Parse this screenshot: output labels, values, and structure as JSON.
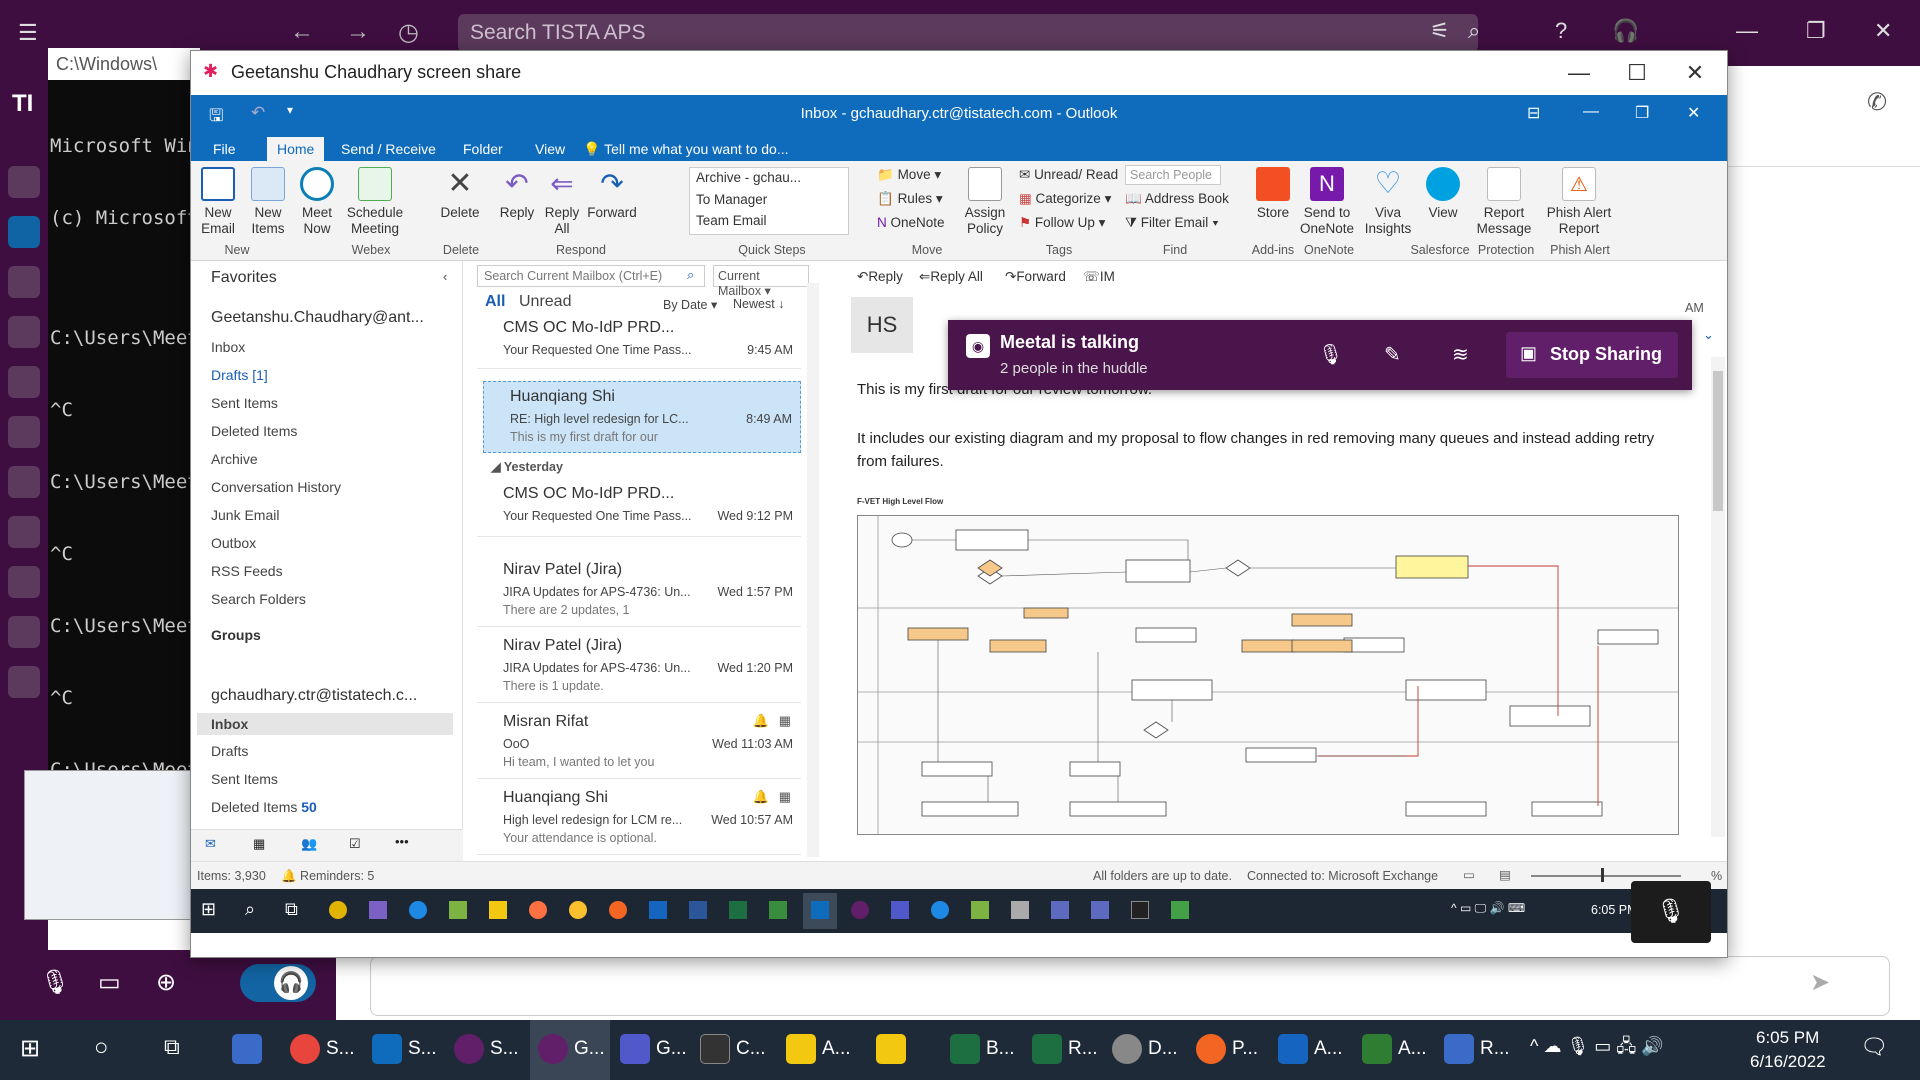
{
  "slack": {
    "search_placeholder": "Search TISTA APS",
    "right_call_icon": "phone-icon"
  },
  "cmd": {
    "title": "C:\\Windows\\",
    "lines": [
      "Microsoft Win",
      "(c) Microsoft",
      "",
      "C:\\Users\\Meet",
      "^C",
      "C:\\Users\\Meet",
      "^C",
      "C:\\Users\\Meet",
      "^C",
      "C:\\Users\\Meet"
    ]
  },
  "share": {
    "title": "Geetanshu Chaudhary screen share"
  },
  "outlook": {
    "title": "Inbox - gchaudhary.ctr@tistatech.com - Outlook",
    "tabs": [
      "File",
      "Home",
      "Send / Receive",
      "Folder",
      "View"
    ],
    "tell_me": "Tell me what you want to do...",
    "ribbon": {
      "new_email": "New Email",
      "new_items": "New Items",
      "meet_now": "Meet Now",
      "schedule_meeting": "Schedule Meeting",
      "delete": "Delete",
      "reply": "Reply",
      "reply_all": "Reply All",
      "forward": "Forward",
      "quick_steps": [
        "Archive - gchau...",
        "To Manager",
        "Team Email"
      ],
      "move": "Move",
      "rules": "Rules",
      "onenote": "OneNote",
      "assign_policy": "Assign Policy",
      "unread_read": "Unread/ Read",
      "categorize": "Categorize",
      "follow_up": "Follow Up",
      "search_people": "Search People",
      "address_book": "Address Book",
      "filter_email": "Filter Email",
      "store": "Store",
      "send_to_onenote": "Send to OneNote",
      "viva_insights": "Viva Insights",
      "view": "View",
      "report_message": "Report Message",
      "phish_alert": "Phish Alert Report",
      "groups": [
        "New",
        "Webex",
        "Delete",
        "Respond",
        "Quick Steps",
        "Move",
        "Tags",
        "Find",
        "Add-ins",
        "OneNote",
        "Salesforce",
        "Protection",
        "Phish Alert"
      ]
    },
    "folders": {
      "favorites": "Favorites",
      "account1": "Geetanshu.Chaudhary@ant...",
      "items1": [
        "Inbox",
        "Drafts [1]",
        "Sent Items",
        "Deleted Items",
        "Archive",
        "Conversation History",
        "Junk Email",
        "Outbox",
        "RSS Feeds",
        "Search Folders"
      ],
      "groups": "Groups",
      "account2": "gchaudhary.ctr@tistatech.c...",
      "items2": [
        "Inbox",
        "Drafts",
        "Sent Items",
        "Deleted Items"
      ],
      "deleted_count": "50"
    },
    "list": {
      "search_placeholder": "Search Current Mailbox (Ctrl+E)",
      "scope": "Current Mailbox",
      "filter_all": "All",
      "filter_unread": "Unread",
      "sort_by": "By Date",
      "sort_order": "Newest",
      "yesterday": "Yesterday",
      "messages": [
        {
          "from": "CMS OC Mo-IdP PRD...",
          "subject": "Your Requested One Time Pass...",
          "time": "9:45 AM",
          "preview": ""
        },
        {
          "from": "Huanqiang Shi",
          "subject": "RE: High level redesign for LC...",
          "time": "8:49 AM",
          "preview": "This is my first draft for our"
        },
        {
          "from": "CMS OC Mo-IdP PRD...",
          "subject": "Your Requested One Time Pass...",
          "time": "Wed 9:12 PM",
          "preview": ""
        },
        {
          "from": "Nirav Patel (Jira)",
          "subject": "JIRA Updates for APS-4736: Un...",
          "time": "Wed 1:57 PM",
          "preview": "There are 2 updates, 1"
        },
        {
          "from": "Nirav Patel (Jira)",
          "subject": "JIRA Updates for APS-4736: Un...",
          "time": "Wed 1:20 PM",
          "preview": "There is 1 update."
        },
        {
          "from": "Misran Rifat",
          "subject": "OoO",
          "time": "Wed 11:03 AM",
          "preview": "Hi team,  I wanted to let you"
        },
        {
          "from": "Huanqiang Shi",
          "subject": "High level redesign for LCM re...",
          "time": "Wed 10:57 AM",
          "preview": "Your attendance is optional."
        }
      ]
    },
    "reading": {
      "actions": [
        "Reply",
        "Reply All",
        "Forward",
        "IM"
      ],
      "avatar": "HS",
      "time_partial": "AM",
      "body1": "This is my first draft for our review tomorrow.",
      "body2": "It includes our existing diagram and my proposal to flow changes in red removing many queues and instead adding retry from failures.",
      "diagram_title": "F-VET High Level Flow"
    },
    "status": {
      "items": "Items: 3,930",
      "reminders": "Reminders: 5",
      "sync": "All folders are up to date.",
      "connection": "Connected to: Microsoft Exchange",
      "zoom": "%"
    },
    "inner_clock": "6:05 PM"
  },
  "huddle": {
    "title": "Meetal is talking",
    "subtitle": "2 people in the huddle",
    "stop": "Stop Sharing"
  },
  "taskbar": {
    "items": [
      {
        "label": "S...",
        "color": "#e8453c"
      },
      {
        "label": "S...",
        "color": "#0f6cbd"
      },
      {
        "label": "S...",
        "color": "#611f69"
      },
      {
        "label": "G...",
        "color": "#611f69"
      },
      {
        "label": "G...",
        "color": "#5059c9"
      },
      {
        "label": "C...",
        "color": "#333333"
      },
      {
        "label": "A...",
        "color": "#f2c811"
      },
      {
        "label": "",
        "color": "#f2c811"
      },
      {
        "label": "B...",
        "color": "#1d6f42"
      },
      {
        "label": "R...",
        "color": "#1d6f42"
      },
      {
        "label": "D...",
        "color": "#888888"
      },
      {
        "label": "P...",
        "color": "#f26522"
      },
      {
        "label": "A...",
        "color": "#1565c0"
      },
      {
        "label": "A...",
        "color": "#2e7d32"
      },
      {
        "label": "R...",
        "color": "#3a6bc9"
      }
    ],
    "time": "6:05 PM",
    "date": "6/16/2022"
  }
}
